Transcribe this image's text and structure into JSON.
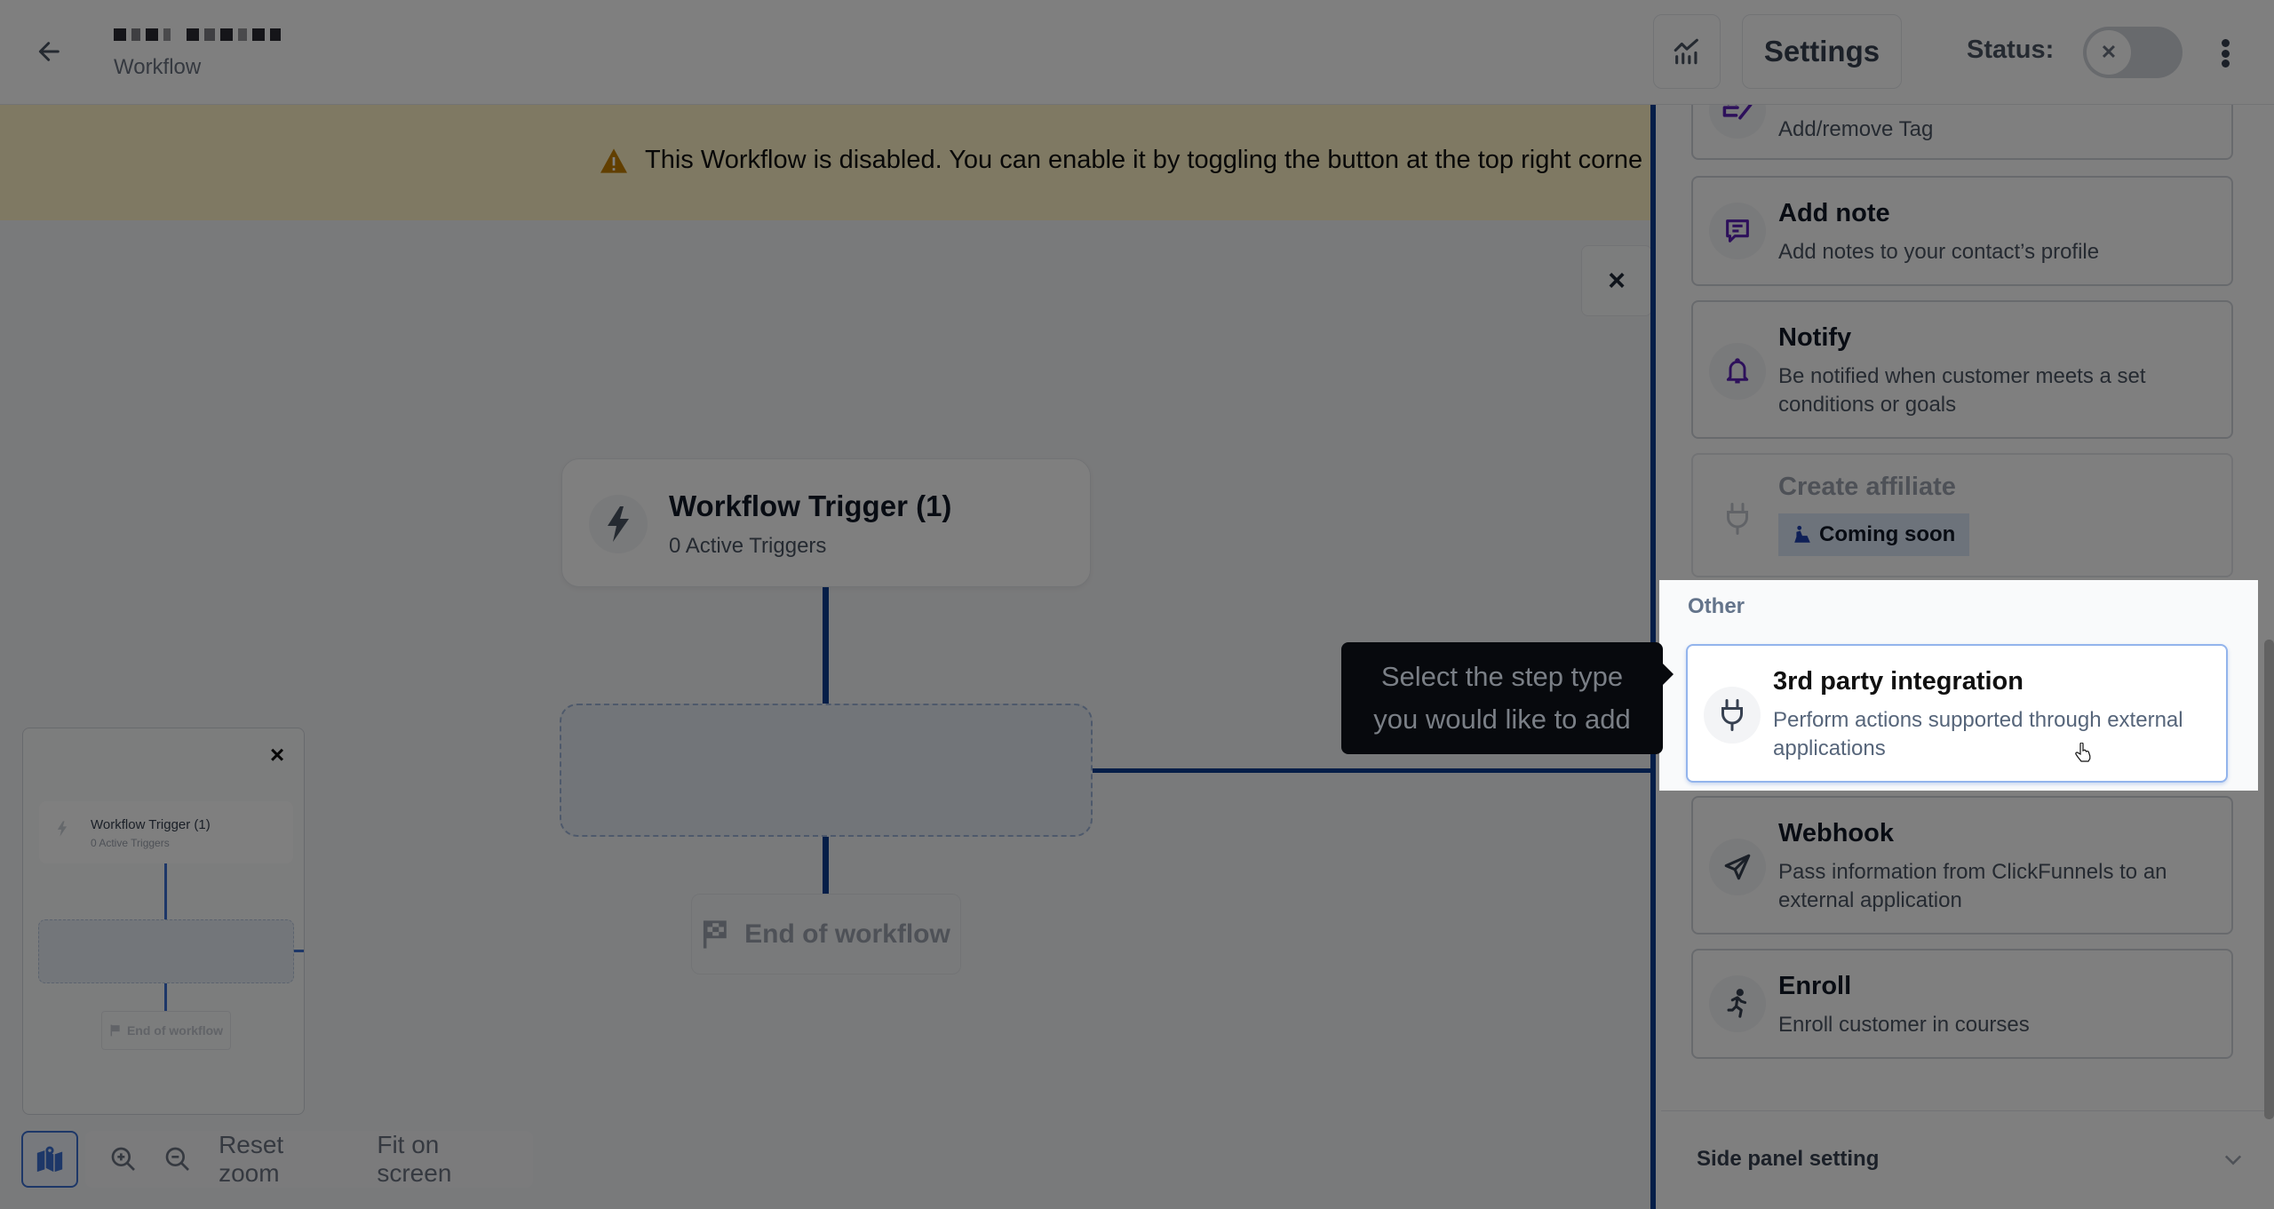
{
  "header": {
    "title_redacted": true,
    "subtitle": "Workflow",
    "settings_label": "Settings",
    "status_label": "Status:",
    "status_enabled": false,
    "icons": {
      "back": "arrow-left-icon",
      "analytics": "chart-icon",
      "toggle": "x-icon",
      "more": "kebab-icon"
    }
  },
  "banner": {
    "icon": "warning-icon",
    "text": "This Workflow is disabled. You can enable it by toggling the button at the top right corne",
    "color": "#fef3c7"
  },
  "canvas": {
    "trigger_node": {
      "title": "Workflow Trigger (1)",
      "subtitle": "0 Active Triggers",
      "icon": "lightning-icon"
    },
    "end_node": {
      "label": "End of workflow",
      "icon": "checkered-flag-icon"
    },
    "close_label": "×",
    "connector_color": "#0b3d91"
  },
  "minimap": {
    "close_label": "×",
    "trigger_title": "Workflow Trigger (1)",
    "trigger_sub": "0 Active Triggers",
    "end_label": "End of workflow"
  },
  "zoom_controls": {
    "map_icon": "map-icon",
    "zoom_in_icon": "zoom-in-icon",
    "zoom_out_icon": "zoom-out-icon",
    "reset_label": "Reset zoom",
    "fit_label": "Fit on screen"
  },
  "panel": {
    "cards": [
      {
        "title": "",
        "desc": "Add/remove Tag",
        "icon": "tag-edit-icon"
      },
      {
        "title": "Add note",
        "desc": "Add notes to your contact’s profile",
        "icon": "note-icon"
      },
      {
        "title": "Notify",
        "desc": "Be notified when customer meets a set conditions or goals",
        "icon": "bell-icon"
      },
      {
        "title": "Create affiliate",
        "badge": "Coming soon",
        "badge_icon": "construction-worker-icon",
        "icon": "plug-icon",
        "disabled": true
      }
    ],
    "other_section": {
      "label": "Other",
      "cards": [
        {
          "title": "3rd party integration",
          "desc": "Perform actions supported through external applications",
          "icon": "plug-icon",
          "highlighted": true
        },
        {
          "title": "Webhook",
          "desc": "Pass information from ClickFunnels to an external application",
          "icon": "paper-plane-icon"
        },
        {
          "title": "Enroll",
          "desc": "Enroll customer in courses",
          "icon": "running-person-icon"
        }
      ]
    },
    "footer": {
      "label": "Side panel setting",
      "icon": "chevron-down-icon"
    }
  },
  "tooltip": {
    "text": "Select the step type you would like to add"
  },
  "colors": {
    "accent_purple": "#5b21b6",
    "connector_blue": "#0b3d91",
    "highlight_border": "#93b4ec"
  }
}
